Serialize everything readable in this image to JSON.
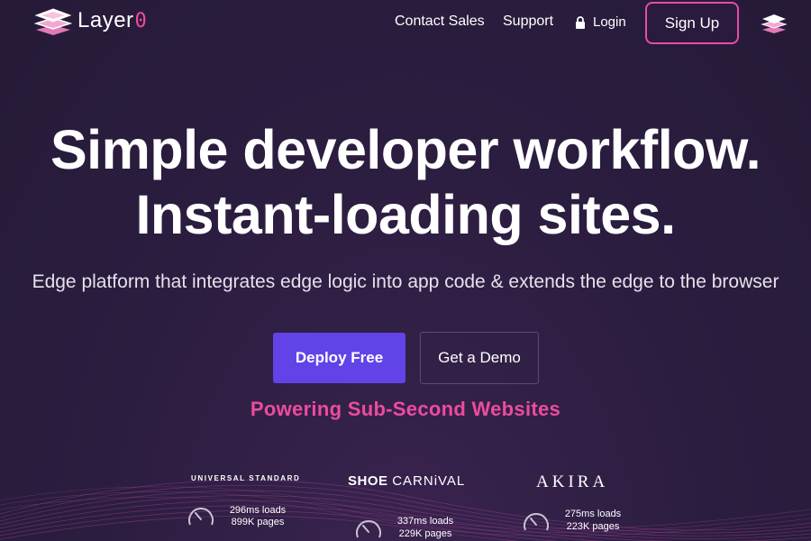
{
  "header": {
    "brand_name": "Layer",
    "brand_zero": "0",
    "nav": {
      "contact_sales": "Contact Sales",
      "support": "Support",
      "login": "Login",
      "sign_up": "Sign Up"
    }
  },
  "hero": {
    "headline_line1": "Simple developer workflow.",
    "headline_line2": "Instant-loading sites.",
    "subheadline": "Edge platform that integrates edge logic into app code & extends the edge to the browser",
    "primary_cta": "Deploy Free",
    "secondary_cta": "Get a Demo",
    "powering": "Powering Sub-Second Websites"
  },
  "customers": [
    {
      "logo": "UNIVERSAL STANDARD",
      "loads": "296ms loads",
      "pages": "899K pages"
    },
    {
      "logo_bold": "SHOE",
      "logo_thin": "CARNiVAL",
      "loads": "337ms loads",
      "pages": "229K pages"
    },
    {
      "logo": "AKIRA",
      "loads": "275ms loads",
      "pages": "223K pages"
    }
  ],
  "colors": {
    "background": "#2b1d3f",
    "accent_pink": "#ed4b9e",
    "primary_button": "#6243e8"
  },
  "icons": [
    "layers-logo-icon",
    "lock-icon",
    "layers-mini-icon",
    "speed-gauge-icon"
  ]
}
